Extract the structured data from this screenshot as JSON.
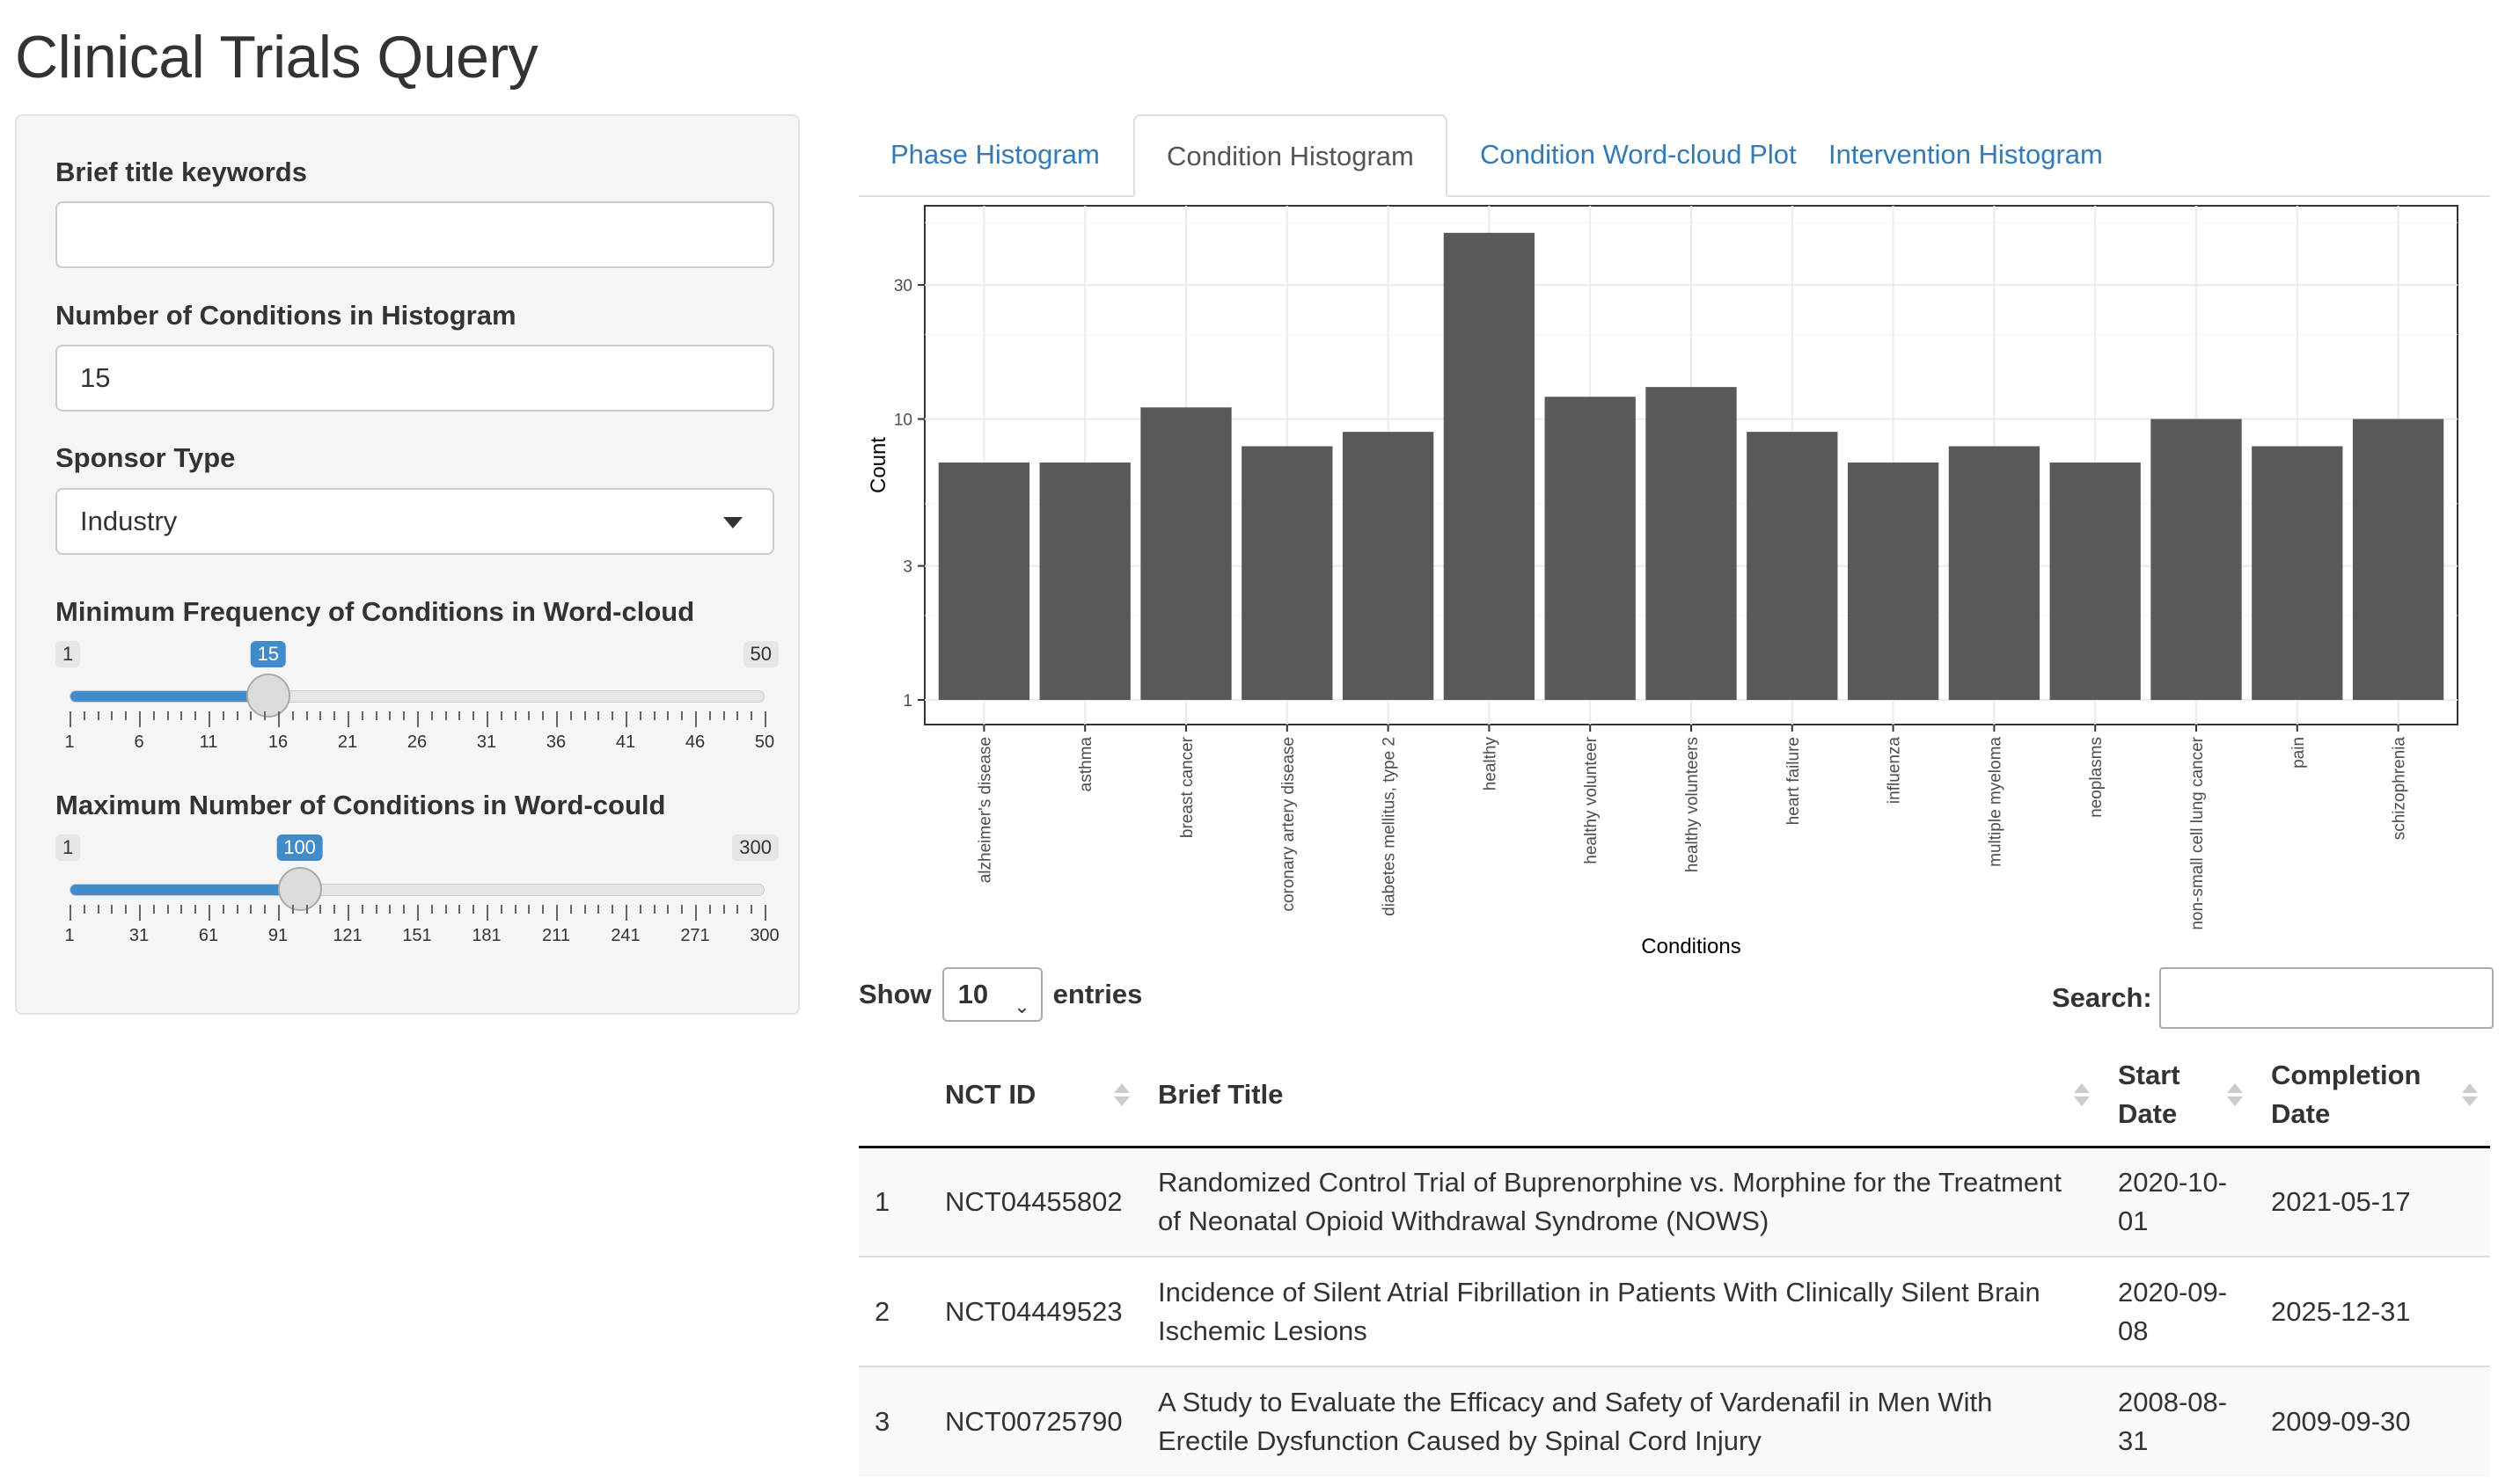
{
  "app": {
    "title": "Clinical Trials Query"
  },
  "sidebar": {
    "keywords": {
      "label": "Brief title keywords",
      "value": ""
    },
    "num_conditions": {
      "label": "Number of Conditions in Histogram",
      "value": "15"
    },
    "sponsor": {
      "label": "Sponsor Type",
      "value": "Industry"
    },
    "min_freq": {
      "label": "Minimum Frequency of Conditions in Word-cloud",
      "min": 1,
      "max": 50,
      "value": 15,
      "min_label": "1",
      "max_label": "50",
      "value_label": "15",
      "ticks": [
        "1",
        "6",
        "11",
        "16",
        "21",
        "26",
        "31",
        "36",
        "41",
        "46",
        "50"
      ]
    },
    "max_words": {
      "label": "Maximum Number of Conditions in Word-could",
      "min": 1,
      "max": 300,
      "value": 100,
      "min_label": "1",
      "max_label": "300",
      "value_label": "100",
      "ticks": [
        "1",
        "31",
        "61",
        "91",
        "121",
        "151",
        "181",
        "211",
        "241",
        "271",
        "300"
      ]
    }
  },
  "tabs": [
    {
      "label": "Phase Histogram",
      "active": false
    },
    {
      "label": "Condition Histogram",
      "active": true
    },
    {
      "label": "Condition Word-cloud Plot",
      "active": false
    },
    {
      "label": "Intervention Histogram",
      "active": false
    }
  ],
  "chart_data": {
    "type": "bar",
    "xlabel": "Conditions",
    "ylabel": "Count",
    "yscale": "log",
    "ylim": [
      1,
      55
    ],
    "yticks": [
      1,
      3,
      10,
      30
    ],
    "grid": true,
    "bar_color": "#595959",
    "categories": [
      "alzheimer's disease",
      "asthma",
      "breast cancer",
      "coronary artery disease",
      "diabetes mellitus, type 2",
      "healthy",
      "healthy volunteer",
      "healthy volunteers",
      "heart failure",
      "influenza",
      "multiple myeloma",
      "neoplasms",
      "non-small cell lung cancer",
      "pain",
      "schizophrenia"
    ],
    "values": [
      7,
      7,
      11,
      8,
      9,
      46,
      12,
      13,
      9,
      7,
      8,
      7,
      10,
      8,
      10
    ]
  },
  "table_controls": {
    "show_label": "Show",
    "entries_value": "10",
    "entries_label": "entries",
    "search_label": "Search:",
    "search_value": ""
  },
  "table": {
    "headers": {
      "index": "",
      "nct": "NCT ID",
      "title": "Brief Title",
      "start": "Start Date",
      "completion": "Completion Date"
    },
    "rows": [
      {
        "idx": "1",
        "nct": "NCT04455802",
        "title": "Randomized Control Trial of Buprenorphine vs. Morphine for the Treatment of Neonatal Opioid Withdrawal Syndrome (NOWS)",
        "start": "2020-10-01",
        "completion": "2021-05-17"
      },
      {
        "idx": "2",
        "nct": "NCT04449523",
        "title": "Incidence of Silent Atrial Fibrillation in Patients With Clinically Silent Brain Ischemic Lesions",
        "start": "2020-09-08",
        "completion": "2025-12-31"
      },
      {
        "idx": "3",
        "nct": "NCT00725790",
        "title": "A Study to Evaluate the Efficacy and Safety of Vardenafil in Men With Erectile Dysfunction Caused by Spinal Cord Injury",
        "start": "2008-08-31",
        "completion": "2009-09-30"
      }
    ]
  }
}
